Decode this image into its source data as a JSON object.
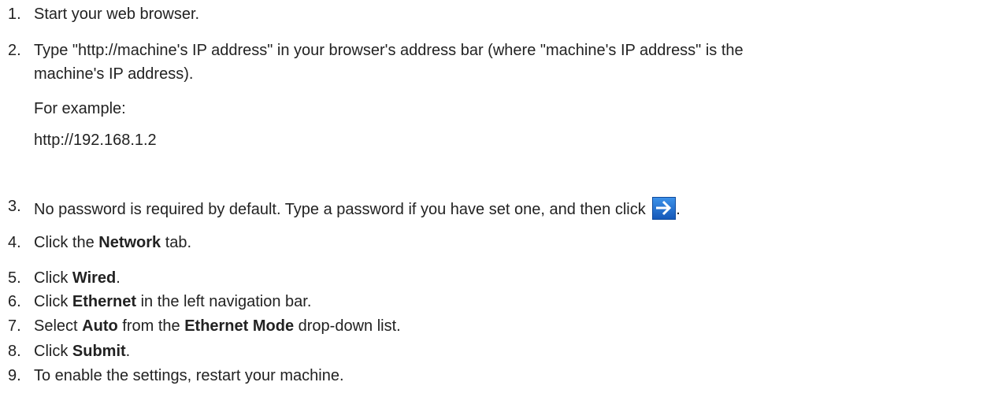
{
  "steps": [
    {
      "num": "1.",
      "text": "Start your web browser."
    },
    {
      "num": "2.",
      "line1": "Type \"http://machine's IP address\" in your browser's address bar (where \"machine's IP address\" is the",
      "line2": "machine's IP address).",
      "example_label": "For example:",
      "example_value": "http://192.168.1.2"
    },
    {
      "num": "3.",
      "text_before": "No password is required by default. Type a password if you have set one, and then click ",
      "text_after": ".",
      "icon": "arrow-right-icon"
    },
    {
      "num": "4.",
      "pre": "Click the ",
      "bold": "Network",
      "post": " tab."
    },
    {
      "num": "5.",
      "pre": "Click ",
      "bold": "Wired",
      "post": "."
    },
    {
      "num": "6.",
      "pre": "Click ",
      "bold": "Ethernet",
      "post": " in the left navigation bar."
    },
    {
      "num": "7.",
      "pre": "Select ",
      "bold1": "Auto",
      "mid": " from the ",
      "bold2": "Ethernet Mode",
      "post": " drop-down list."
    },
    {
      "num": "8.",
      "pre": "Click ",
      "bold": "Submit",
      "post": "."
    },
    {
      "num": "9.",
      "text": "To enable the settings, restart your machine."
    }
  ],
  "colors": {
    "text": "#222222",
    "arrow_button_blue": "#1e74d6"
  }
}
